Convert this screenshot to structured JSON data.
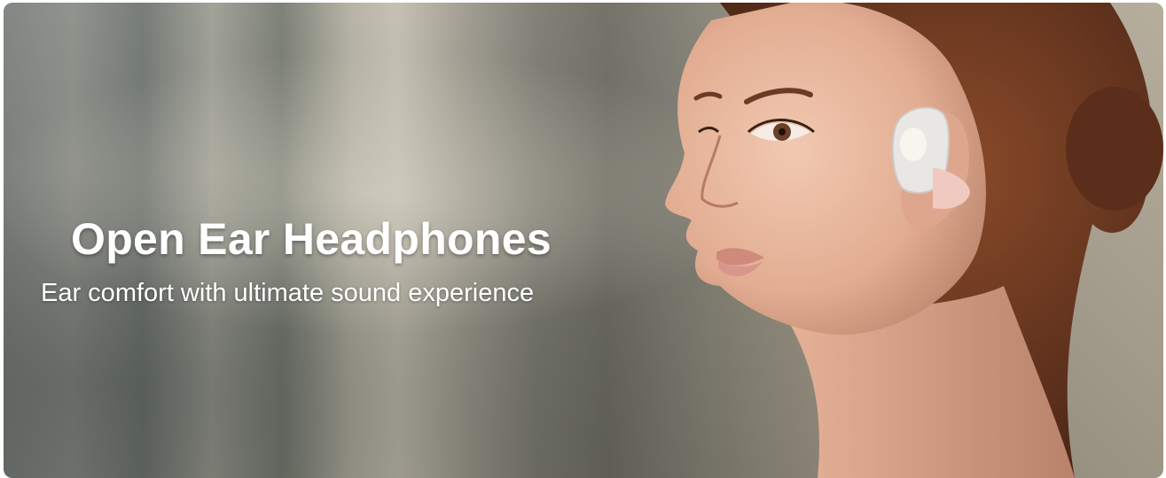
{
  "banner": {
    "headline": "Open Ear Headphones",
    "subheadline": "Ear comfort with ultimate sound experience",
    "image_subject": "woman-wearing-earbud",
    "colors": {
      "text": "#ffffff",
      "background_left": "#7b807c",
      "background_right": "#b2a997",
      "skin": "#e8b9a0",
      "hair": "#6b3a22",
      "earbud": "#e9e7e4",
      "earbud_accent": "#f0c9c0"
    }
  }
}
